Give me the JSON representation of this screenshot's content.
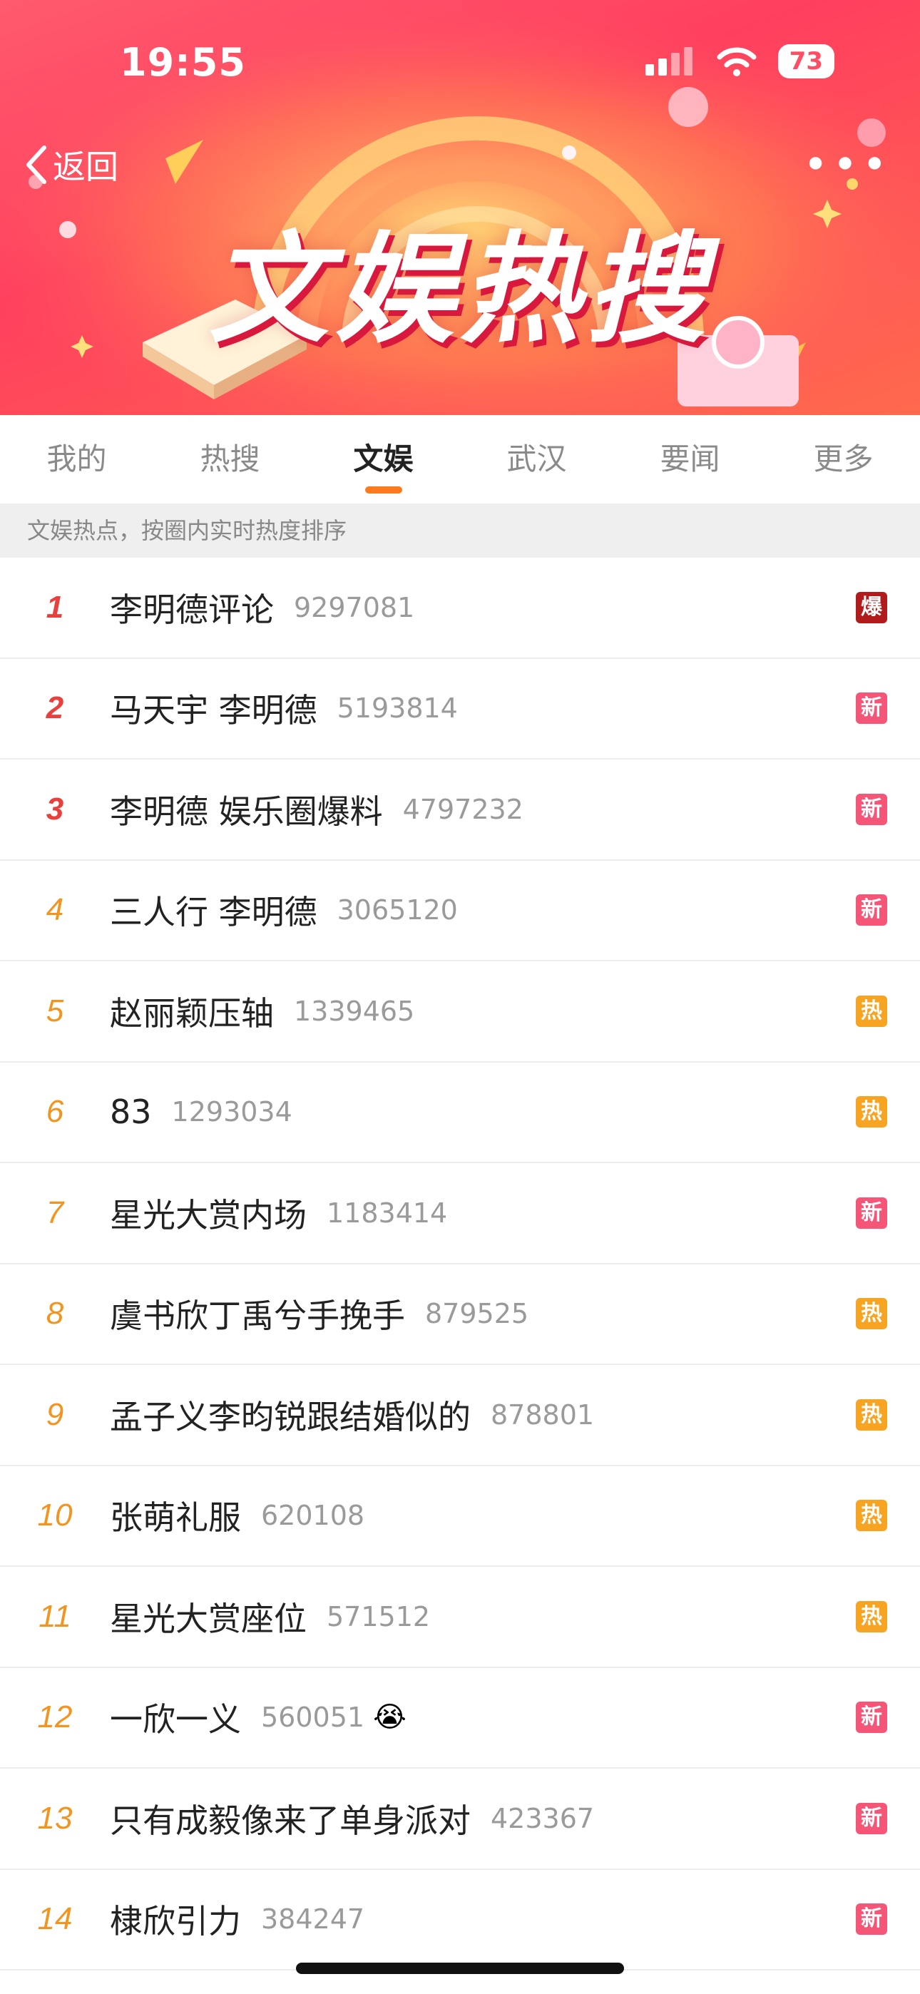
{
  "status_bar": {
    "time": "19:55",
    "battery": "73"
  },
  "nav": {
    "back_label": "返回",
    "more_label": "•••"
  },
  "banner": {
    "title": "文娱热搜"
  },
  "tabs": [
    {
      "label": "我的"
    },
    {
      "label": "热搜"
    },
    {
      "label": "文娱"
    },
    {
      "label": "武汉"
    },
    {
      "label": "要闻"
    },
    {
      "label": "更多"
    }
  ],
  "subheader": "文娱热点，按圈内实时热度排序",
  "list": [
    {
      "rank": "1",
      "title": "李明德评论",
      "count": "9297081",
      "badge": "爆"
    },
    {
      "rank": "2",
      "title": "马天宇 李明德",
      "count": "5193814",
      "badge": "新"
    },
    {
      "rank": "3",
      "title": "李明德 娱乐圈爆料",
      "count": "4797232",
      "badge": "新"
    },
    {
      "rank": "4",
      "title": "三人行 李明德",
      "count": "3065120",
      "badge": "新"
    },
    {
      "rank": "5",
      "title": "赵丽颖压轴",
      "count": "1339465",
      "badge": "热"
    },
    {
      "rank": "6",
      "title": "83",
      "count": "1293034",
      "badge": "热"
    },
    {
      "rank": "7",
      "title": "星光大赏内场",
      "count": "1183414",
      "badge": "新"
    },
    {
      "rank": "8",
      "title": "虞书欣丁禹兮手挽手",
      "count": "879525",
      "badge": "热"
    },
    {
      "rank": "9",
      "title": "孟子义李昀锐跟结婚似的",
      "count": "878801",
      "badge": "热"
    },
    {
      "rank": "10",
      "title": "张萌礼服",
      "count": "620108",
      "badge": "热"
    },
    {
      "rank": "11",
      "title": "星光大赏座位",
      "count": "571512",
      "badge": "热"
    },
    {
      "rank": "12",
      "title": "一欣一义",
      "count": "560051",
      "badge": "新",
      "emoji": "😭"
    },
    {
      "rank": "13",
      "title": "只有成毅像来了单身派对",
      "count": "423367",
      "badge": "新"
    },
    {
      "rank": "14",
      "title": "棣欣引力",
      "count": "384247",
      "badge": "新"
    }
  ],
  "colors": {
    "banner_gradient_start": "#ff5a6e",
    "banner_gradient_end": "#ff6a4d",
    "tab_indicator": "#ff7a1c",
    "rank_top": "#e8413d",
    "rank_other": "#f29420",
    "badge_bao": "#b21b1b",
    "badge_xin": "#f55577",
    "badge_re": "#f6a422"
  }
}
